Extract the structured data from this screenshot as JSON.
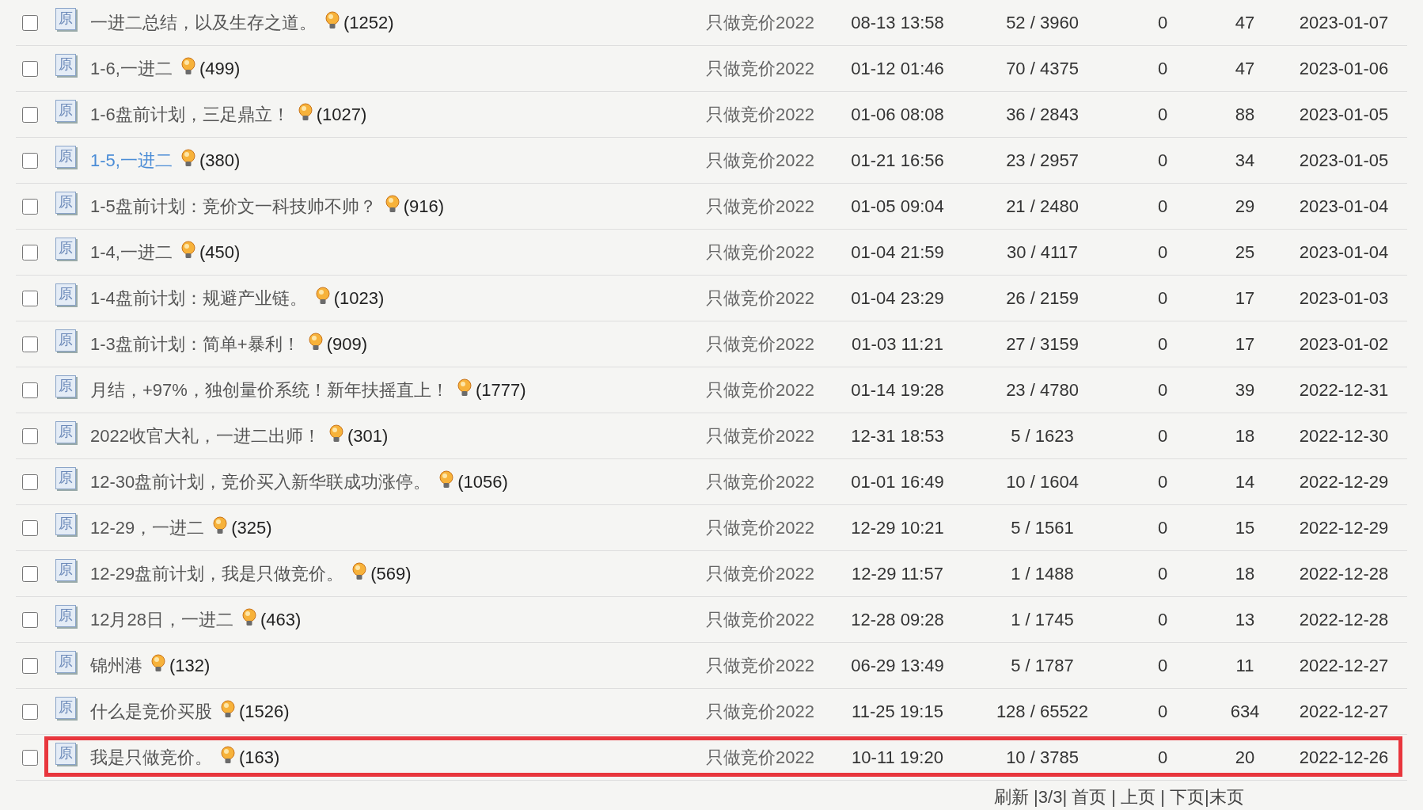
{
  "rows": [
    {
      "checked": false,
      "badge": "原",
      "title": "一进二总结，以及生存之道。",
      "hovered": false,
      "count": "(1252)",
      "author": "只做竞价2022",
      "last_reply": "08-13 13:58",
      "replies_views": "52 / 3960",
      "column_6": "0",
      "column_7": "47",
      "date": "2023-01-07",
      "highlighted": false
    },
    {
      "checked": false,
      "badge": "原",
      "title": "1-6,一进二",
      "hovered": false,
      "count": "(499)",
      "author": "只做竞价2022",
      "last_reply": "01-12 01:46",
      "replies_views": "70 / 4375",
      "column_6": "0",
      "column_7": "47",
      "date": "2023-01-06",
      "highlighted": false
    },
    {
      "checked": false,
      "badge": "原",
      "title": "1-6盘前计划，三足鼎立！",
      "hovered": false,
      "count": "(1027)",
      "author": "只做竞价2022",
      "last_reply": "01-06 08:08",
      "replies_views": "36 / 2843",
      "column_6": "0",
      "column_7": "88",
      "date": "2023-01-05",
      "highlighted": false
    },
    {
      "checked": false,
      "badge": "原",
      "title": "1-5,一进二",
      "hovered": true,
      "count": "(380)",
      "author": "只做竞价2022",
      "last_reply": "01-21 16:56",
      "replies_views": "23 / 2957",
      "column_6": "0",
      "column_7": "34",
      "date": "2023-01-05",
      "highlighted": false
    },
    {
      "checked": false,
      "badge": "原",
      "title": "1-5盘前计划：竞价文一科技帅不帅？",
      "hovered": false,
      "count": "(916)",
      "author": "只做竞价2022",
      "last_reply": "01-05 09:04",
      "replies_views": "21 / 2480",
      "column_6": "0",
      "column_7": "29",
      "date": "2023-01-04",
      "highlighted": false
    },
    {
      "checked": false,
      "badge": "原",
      "title": "1-4,一进二",
      "hovered": false,
      "count": "(450)",
      "author": "只做竞价2022",
      "last_reply": "01-04 21:59",
      "replies_views": "30 / 4117",
      "column_6": "0",
      "column_7": "25",
      "date": "2023-01-04",
      "highlighted": false
    },
    {
      "checked": false,
      "badge": "原",
      "title": "1-4盘前计划：规避产业链。",
      "hovered": false,
      "count": "(1023)",
      "author": "只做竞价2022",
      "last_reply": "01-04 23:29",
      "replies_views": "26 / 2159",
      "column_6": "0",
      "column_7": "17",
      "date": "2023-01-03",
      "highlighted": false
    },
    {
      "checked": false,
      "badge": "原",
      "title": "1-3盘前计划：简单+暴利！",
      "hovered": false,
      "count": "(909)",
      "author": "只做竞价2022",
      "last_reply": "01-03 11:21",
      "replies_views": "27 / 3159",
      "column_6": "0",
      "column_7": "17",
      "date": "2023-01-02",
      "highlighted": false
    },
    {
      "checked": false,
      "badge": "原",
      "title": "月结，+97%，独创量价系统！新年扶摇直上！",
      "hovered": false,
      "count": "(1777)",
      "author": "只做竞价2022",
      "last_reply": "01-14 19:28",
      "replies_views": "23 / 4780",
      "column_6": "0",
      "column_7": "39",
      "date": "2022-12-31",
      "highlighted": false
    },
    {
      "checked": false,
      "badge": "原",
      "title": "2022收官大礼，一进二出师！",
      "hovered": false,
      "count": "(301)",
      "author": "只做竞价2022",
      "last_reply": "12-31 18:53",
      "replies_views": "5 / 1623",
      "column_6": "0",
      "column_7": "18",
      "date": "2022-12-30",
      "highlighted": false
    },
    {
      "checked": false,
      "badge": "原",
      "title": "12-30盘前计划，竞价买入新华联成功涨停。",
      "hovered": false,
      "count": "(1056)",
      "author": "只做竞价2022",
      "last_reply": "01-01 16:49",
      "replies_views": "10 / 1604",
      "column_6": "0",
      "column_7": "14",
      "date": "2022-12-29",
      "highlighted": false
    },
    {
      "checked": false,
      "badge": "原",
      "title": "12-29，一进二",
      "hovered": false,
      "count": "(325)",
      "author": "只做竞价2022",
      "last_reply": "12-29 10:21",
      "replies_views": "5 / 1561",
      "column_6": "0",
      "column_7": "15",
      "date": "2022-12-29",
      "highlighted": false
    },
    {
      "checked": false,
      "badge": "原",
      "title": "12-29盘前计划，我是只做竞价。",
      "hovered": false,
      "count": "(569)",
      "author": "只做竞价2022",
      "last_reply": "12-29 11:57",
      "replies_views": "1 / 1488",
      "column_6": "0",
      "column_7": "18",
      "date": "2022-12-28",
      "highlighted": false
    },
    {
      "checked": false,
      "badge": "原",
      "title": "12月28日，一进二",
      "hovered": false,
      "count": "(463)",
      "author": "只做竞价2022",
      "last_reply": "12-28 09:28",
      "replies_views": "1 / 1745",
      "column_6": "0",
      "column_7": "13",
      "date": "2022-12-28",
      "highlighted": false
    },
    {
      "checked": false,
      "badge": "原",
      "title": "锦州港",
      "hovered": false,
      "count": "(132)",
      "author": "只做竞价2022",
      "last_reply": "06-29 13:49",
      "replies_views": "5 / 1787",
      "column_6": "0",
      "column_7": "11",
      "date": "2022-12-27",
      "highlighted": false
    },
    {
      "checked": false,
      "badge": "原",
      "title": "什么是竞价买股",
      "hovered": false,
      "count": "(1526)",
      "author": "只做竞价2022",
      "last_reply": "11-25 19:15",
      "replies_views": "128 / 65522",
      "column_6": "0",
      "column_7": "634",
      "date": "2022-12-27",
      "highlighted": false
    },
    {
      "checked": false,
      "badge": "原",
      "title": "我是只做竞价。",
      "hovered": false,
      "count": "(163)",
      "author": "只做竞价2022",
      "last_reply": "10-11 19:20",
      "replies_views": "10 / 3785",
      "column_6": "0",
      "column_7": "20",
      "date": "2022-12-26",
      "highlighted": true
    }
  ],
  "pagination": "刷新 |3/3| 首页 | 上页 | 下页|末页"
}
